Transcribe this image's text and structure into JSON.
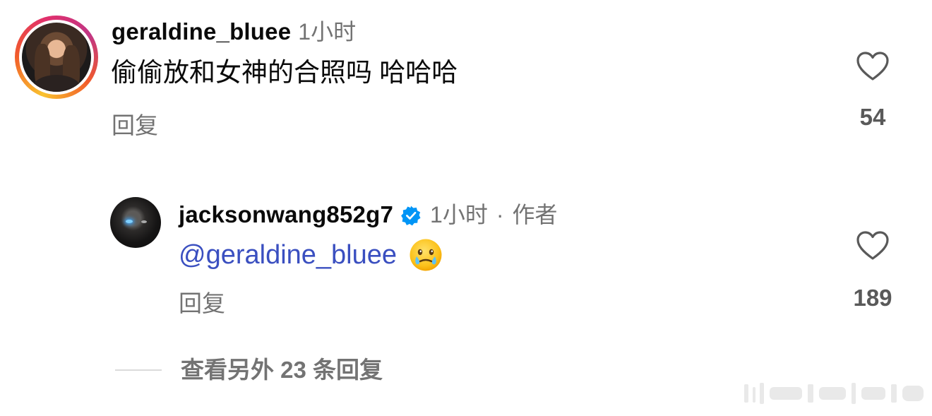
{
  "comments": [
    {
      "username": "geraldine_bluee",
      "time": "1小时",
      "text": "偷偷放和女神的合照吗 哈哈哈",
      "reply_label": "回复",
      "likes": "54",
      "has_story_ring": true
    },
    {
      "username": "jacksonwang852g7",
      "verified": true,
      "time": "1小时",
      "separator": "·",
      "author_tag": "作者",
      "mention": "@geraldine_bluee",
      "emoji": "face-holding-back-tears",
      "reply_label": "回复",
      "likes": "189"
    }
  ],
  "view_more": {
    "label": "查看另外 23 条回复"
  },
  "icons": {
    "like": "heart-outline-icon",
    "verified": "verified-badge-icon"
  },
  "colors": {
    "mention": "#3a4fc0",
    "verified": "#0095f6",
    "secondary_text": "#737373"
  }
}
